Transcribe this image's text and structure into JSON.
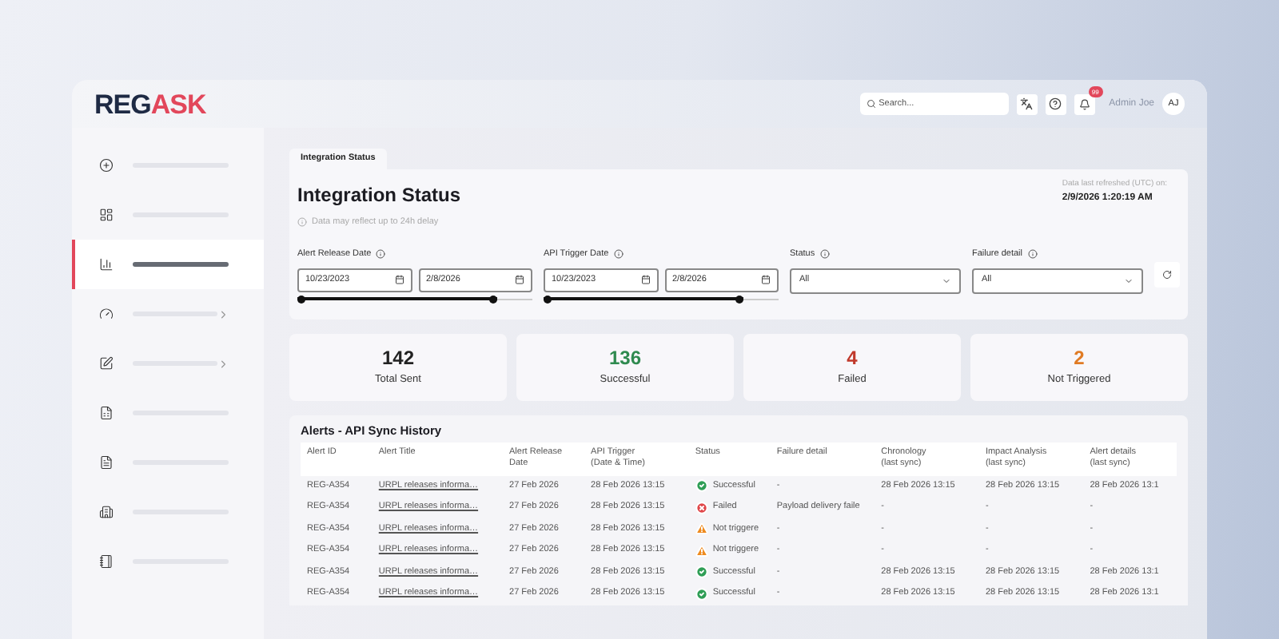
{
  "header": {
    "logo": {
      "first": "REG",
      "second": "ASK"
    },
    "search": {
      "placeholder": "Search..."
    },
    "notifications_badge": "99",
    "user_name": "Admin Joe",
    "avatar": "AJ"
  },
  "sidebar": {
    "items": [
      {
        "selected": false,
        "expandable": false
      },
      {
        "selected": false,
        "expandable": false
      },
      {
        "selected": true,
        "expandable": false
      },
      {
        "selected": false,
        "expandable": true
      },
      {
        "selected": false,
        "expandable": true
      },
      {
        "selected": false,
        "expandable": false
      },
      {
        "selected": false,
        "expandable": false
      },
      {
        "selected": false,
        "expandable": false
      },
      {
        "selected": false,
        "expandable": false
      }
    ]
  },
  "tabs": [
    {
      "label": "Integration Status",
      "selected": true
    }
  ],
  "panel": {
    "title": "Integration Status",
    "note": "Data may reflect up to 24h delay",
    "refreshed_label": "Data last refreshed (UTC) on:",
    "refreshed_value": "2/9/2026 1:20:19 AM",
    "filters": [
      {
        "kind": "date_range",
        "label": "Alert Release Date",
        "from": "10/23/2023",
        "to": "2/8/2026",
        "slider": {
          "level": 0.85
        }
      },
      {
        "kind": "date_range",
        "label": "API Trigger Date",
        "from": "10/23/2023",
        "to": "2/8/2026",
        "slider": {
          "level": 0.85
        }
      },
      {
        "kind": "select",
        "label": "Status",
        "value": "All"
      },
      {
        "kind": "select",
        "label": "Failure detail",
        "value": "All"
      }
    ]
  },
  "stats": [
    {
      "value": "142",
      "label": "Total Sent",
      "color": "#222222"
    },
    {
      "value": "136",
      "label": "Successful",
      "color": "#2f8a4f"
    },
    {
      "value": "4",
      "label": "Failed",
      "color": "#c0392b"
    },
    {
      "value": "2",
      "label": "Not Triggered",
      "color": "#e07b24"
    }
  ],
  "table": {
    "title": "Alerts - API Sync History",
    "columns": [
      [
        "Alert ID"
      ],
      [
        "Alert Title"
      ],
      [
        "Alert Release",
        "Date"
      ],
      [
        "API Trigger",
        "(Date & Time)"
      ],
      [
        "Status"
      ],
      [
        "Failure detail"
      ],
      [
        "Chronology",
        "(last sync)"
      ],
      [
        "Impact Analysis",
        "(last sync)"
      ],
      [
        "Alert details",
        "(last sync)"
      ]
    ],
    "rows": [
      {
        "id": "REG-A354",
        "title": "URPL releases informa…",
        "release": "27 Feb 2026",
        "trigger": "28 Feb 2026 13:15",
        "status": {
          "kind": "success",
          "text": "Successful"
        },
        "failure": "-",
        "chronology": "28 Feb 2026 13:15",
        "impact": "28 Feb 2026 13:15",
        "details": "28 Feb 2026 13:1"
      },
      {
        "id": "REG-A354",
        "title": "URPL releases informa…",
        "release": "27 Feb 2026",
        "trigger": "28 Feb 2026 13:15",
        "status": {
          "kind": "failed",
          "text": "Failed"
        },
        "failure": "Payload delivery faile",
        "chronology": "-",
        "impact": "-",
        "details": "-"
      },
      {
        "id": "REG-A354",
        "title": "URPL releases informa…",
        "release": "27 Feb 2026",
        "trigger": "28 Feb 2026 13:15",
        "status": {
          "kind": "not_triggered",
          "text": "Not triggere"
        },
        "failure": "-",
        "chronology": "-",
        "impact": "-",
        "details": "-"
      },
      {
        "id": "REG-A354",
        "title": "URPL releases informa…",
        "release": "27 Feb 2026",
        "trigger": "28 Feb 2026 13:15",
        "status": {
          "kind": "not_triggered",
          "text": "Not triggere"
        },
        "failure": "-",
        "chronology": "-",
        "impact": "-",
        "details": "-"
      },
      {
        "id": "REG-A354",
        "title": "URPL releases informa…",
        "release": "27 Feb 2026",
        "trigger": "28 Feb 2026 13:15",
        "status": {
          "kind": "success",
          "text": "Successful"
        },
        "failure": "-",
        "chronology": "28 Feb 2026 13:15",
        "impact": "28 Feb 2026 13:15",
        "details": "28 Feb 2026 13:1"
      },
      {
        "id": "REG-A354",
        "title": "URPL releases informa…",
        "release": "27 Feb 2026",
        "trigger": "28 Feb 2026 13:15",
        "status": {
          "kind": "success",
          "text": "Successful"
        },
        "failure": "-",
        "chronology": "28 Feb 2026 13:15",
        "impact": "28 Feb 2026 13:15",
        "details": "28 Feb 2026 13:1"
      }
    ]
  }
}
